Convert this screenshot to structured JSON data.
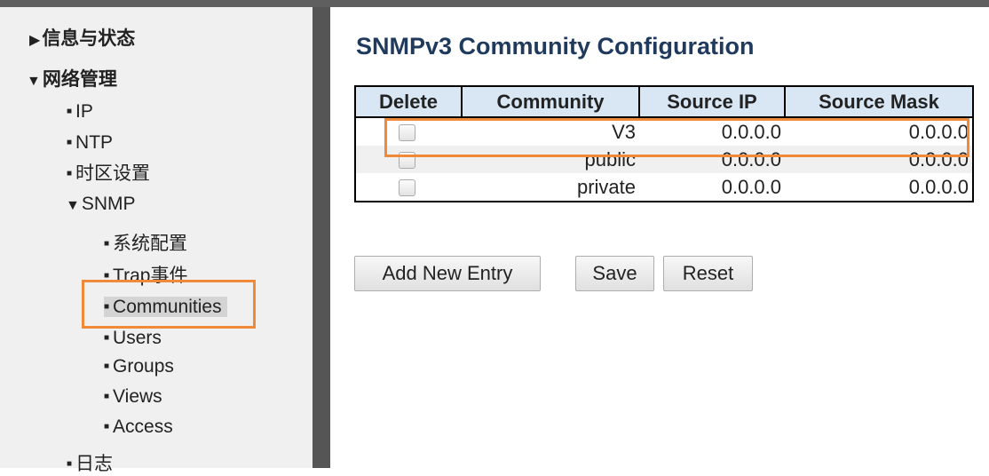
{
  "sidebar": {
    "items": [
      {
        "label": "信息与状态",
        "icon": "triangle-right-icon"
      },
      {
        "label": "网络管理",
        "icon": "triangle-down-icon"
      },
      {
        "label": "IP",
        "icon": "bullet-icon"
      },
      {
        "label": "NTP",
        "icon": "bullet-icon"
      },
      {
        "label": "时区设置",
        "icon": "bullet-icon"
      },
      {
        "label": "SNMP",
        "icon": "triangle-down-icon"
      },
      {
        "label": "系统配置",
        "icon": "bullet-icon"
      },
      {
        "label": "Trap事件",
        "icon": "bullet-icon"
      },
      {
        "label": "Communities",
        "icon": "bullet-icon",
        "selected": true
      },
      {
        "label": "Users",
        "icon": "bullet-icon"
      },
      {
        "label": "Groups",
        "icon": "bullet-icon"
      },
      {
        "label": "Views",
        "icon": "bullet-icon"
      },
      {
        "label": "Access",
        "icon": "bullet-icon"
      },
      {
        "label": "日志",
        "icon": "bullet-icon"
      }
    ]
  },
  "main": {
    "title": "SNMPv3 Community Configuration",
    "table": {
      "headers": [
        "Delete",
        "Community",
        "Source IP",
        "Source Mask"
      ],
      "rows": [
        {
          "community": "V3",
          "source_ip": "0.0.0.0",
          "source_mask": "0.0.0.0"
        },
        {
          "community": "public",
          "source_ip": "0.0.0.0",
          "source_mask": "0.0.0.0"
        },
        {
          "community": "private",
          "source_ip": "0.0.0.0",
          "source_mask": "0.0.0.0"
        }
      ]
    },
    "buttons": {
      "add": "Add New Entry",
      "save": "Save",
      "reset": "Reset"
    }
  },
  "colors": {
    "highlight_box": "#ee8a3a",
    "title": "#1f3a5c",
    "header_bg": "#d9e7f4",
    "divider": "#555555"
  }
}
